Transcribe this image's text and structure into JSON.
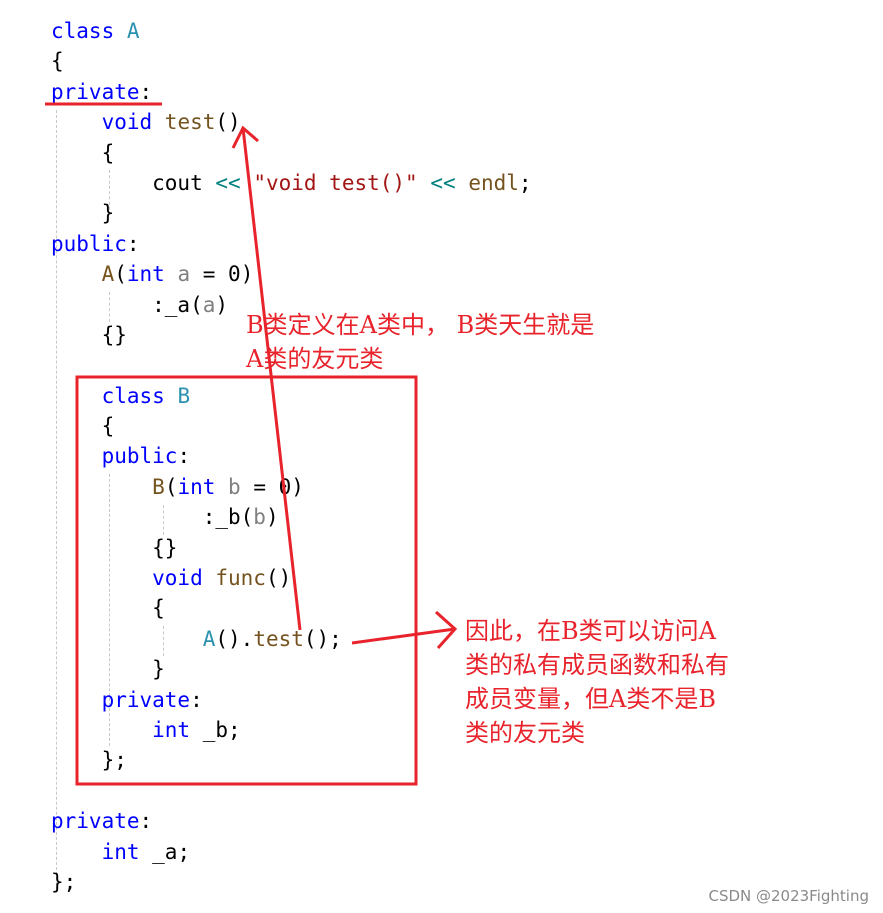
{
  "code": {
    "lines": [
      [
        {
          "t": "class ",
          "c": "kw"
        },
        {
          "t": "A",
          "c": "cls"
        }
      ],
      [
        {
          "t": "{",
          "c": ""
        }
      ],
      [
        {
          "t": "private",
          "c": "kw"
        },
        {
          "t": ":",
          "c": ""
        }
      ],
      [
        {
          "t": "    void ",
          "c": "kw"
        },
        {
          "t": "test",
          "c": "fn"
        },
        {
          "t": "()",
          "c": ""
        }
      ],
      [
        {
          "t": "    {",
          "c": ""
        }
      ],
      [
        {
          "t": "        cout ",
          "c": ""
        },
        {
          "t": "<<",
          "c": "op"
        },
        {
          "t": " ",
          "c": ""
        },
        {
          "t": "\"void test()\"",
          "c": "str"
        },
        {
          "t": " ",
          "c": ""
        },
        {
          "t": "<<",
          "c": "op"
        },
        {
          "t": " ",
          "c": ""
        },
        {
          "t": "endl",
          "c": "fn"
        },
        {
          "t": ";",
          "c": ""
        }
      ],
      [
        {
          "t": "    }",
          "c": ""
        }
      ],
      [
        {
          "t": "public",
          "c": "kw"
        },
        {
          "t": ":",
          "c": ""
        }
      ],
      [
        {
          "t": "    ",
          "c": ""
        },
        {
          "t": "A",
          "c": "fn"
        },
        {
          "t": "(",
          "c": ""
        },
        {
          "t": "int ",
          "c": "kw"
        },
        {
          "t": "a",
          "c": "param"
        },
        {
          "t": " = 0)",
          "c": ""
        }
      ],
      [
        {
          "t": "        :_a(",
          "c": ""
        },
        {
          "t": "a",
          "c": "param"
        },
        {
          "t": ")",
          "c": ""
        }
      ],
      [
        {
          "t": "    {}",
          "c": ""
        }
      ],
      [
        {
          "t": "",
          "c": ""
        }
      ],
      [
        {
          "t": "    class ",
          "c": "kw"
        },
        {
          "t": "B",
          "c": "cls"
        }
      ],
      [
        {
          "t": "    {",
          "c": ""
        }
      ],
      [
        {
          "t": "    public",
          "c": "kw"
        },
        {
          "t": ":",
          "c": ""
        }
      ],
      [
        {
          "t": "        ",
          "c": ""
        },
        {
          "t": "B",
          "c": "fn"
        },
        {
          "t": "(",
          "c": ""
        },
        {
          "t": "int ",
          "c": "kw"
        },
        {
          "t": "b",
          "c": "param"
        },
        {
          "t": " = 0)",
          "c": ""
        }
      ],
      [
        {
          "t": "            :_b(",
          "c": ""
        },
        {
          "t": "b",
          "c": "param"
        },
        {
          "t": ")",
          "c": ""
        }
      ],
      [
        {
          "t": "        {}",
          "c": ""
        }
      ],
      [
        {
          "t": "        void ",
          "c": "kw"
        },
        {
          "t": "func",
          "c": "fn"
        },
        {
          "t": "()",
          "c": ""
        }
      ],
      [
        {
          "t": "        {",
          "c": ""
        }
      ],
      [
        {
          "t": "            ",
          "c": ""
        },
        {
          "t": "A",
          "c": "cls"
        },
        {
          "t": "().",
          "c": ""
        },
        {
          "t": "test",
          "c": "fn"
        },
        {
          "t": "();",
          "c": ""
        }
      ],
      [
        {
          "t": "        }",
          "c": ""
        }
      ],
      [
        {
          "t": "    private",
          "c": "kw"
        },
        {
          "t": ":",
          "c": ""
        }
      ],
      [
        {
          "t": "        int ",
          "c": "kw"
        },
        {
          "t": "_b;",
          "c": ""
        }
      ],
      [
        {
          "t": "    };",
          "c": ""
        }
      ],
      [
        {
          "t": "",
          "c": ""
        }
      ],
      [
        {
          "t": "private",
          "c": "kw"
        },
        {
          "t": ":",
          "c": ""
        }
      ],
      [
        {
          "t": "    int ",
          "c": "kw"
        },
        {
          "t": "_a;",
          "c": ""
        }
      ],
      [
        {
          "t": "};",
          "c": ""
        }
      ]
    ]
  },
  "annotations": {
    "note_top": {
      "line1": "B类定义在A类中， B类天生就是",
      "line2": "A类的友元类"
    },
    "note_right": {
      "line1": "因此，在B类可以访问A",
      "line2": "类的私有成员函数和私有",
      "line3": "成员变量，但A类不是B",
      "line4": "类的友元类"
    },
    "color": "#e8232b"
  },
  "watermark": "CSDN @2023Fighting"
}
